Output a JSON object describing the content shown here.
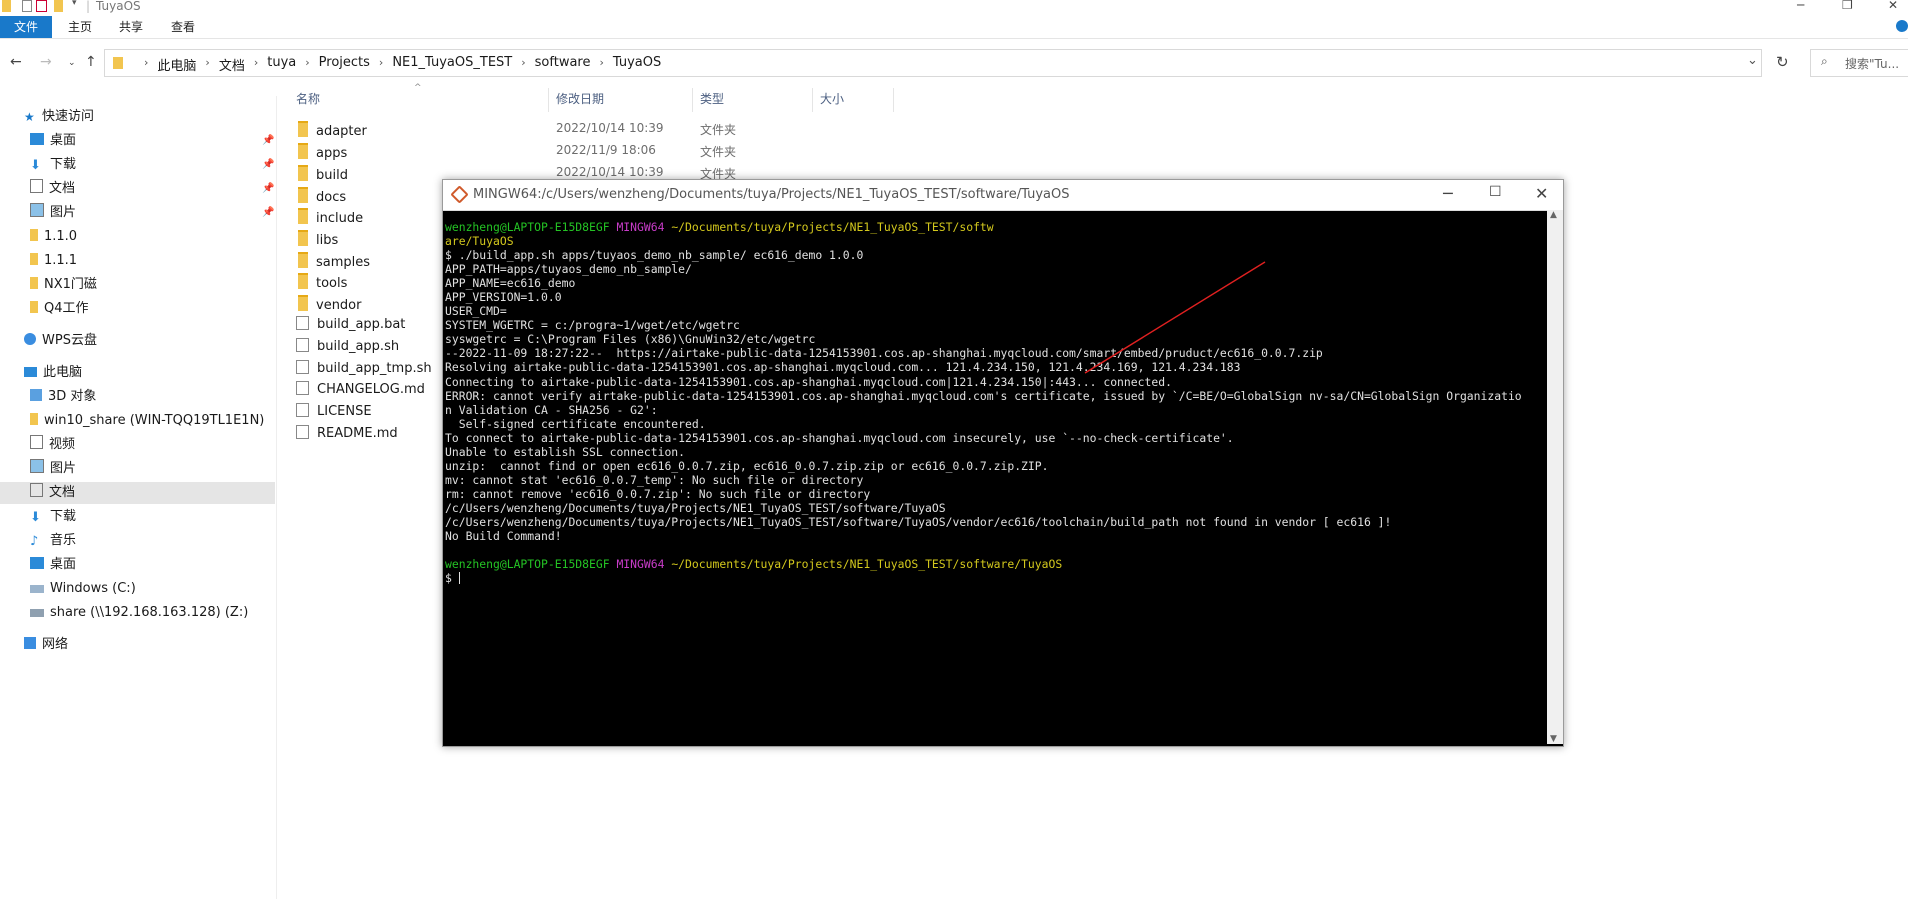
{
  "window": {
    "title": "TuyaOS"
  },
  "ribbon": {
    "tabs": [
      "文件",
      "主页",
      "共享",
      "查看"
    ]
  },
  "address": {
    "crumbs": [
      "此电脑",
      "文档",
      "tuya",
      "Projects",
      "NE1_TuyaOS_TEST",
      "software",
      "TuyaOS"
    ],
    "search_placeholder": "搜索\"Tu..."
  },
  "sidebar": {
    "quick_access": "快速访问",
    "quick_items": [
      "桌面",
      "下载",
      "文档",
      "图片",
      "1.1.0",
      "1.1.1",
      "NX1门磁",
      "Q4工作"
    ],
    "wps": "WPS云盘",
    "this_pc": "此电脑",
    "pc_items": [
      "3D 对象",
      "win10_share (WIN-TQQ19TL1E1N)",
      "视频",
      "图片",
      "文档",
      "下载",
      "音乐",
      "桌面",
      "Windows (C:)",
      "share (\\\\192.168.163.128) (Z:)"
    ],
    "network": "网络"
  },
  "columns": {
    "name": "名称",
    "date": "修改日期",
    "type": "类型",
    "size": "大小"
  },
  "files": [
    {
      "name": "adapter",
      "date": "2022/10/14 10:39",
      "type": "文件夹"
    },
    {
      "name": "apps",
      "date": "2022/11/9 18:06",
      "type": "文件夹"
    },
    {
      "name": "build",
      "date": "2022/10/14 10:39",
      "type": "文件夹"
    },
    {
      "name": "docs",
      "date": "",
      "type": ""
    },
    {
      "name": "include",
      "date": "",
      "type": ""
    },
    {
      "name": "libs",
      "date": "",
      "type": ""
    },
    {
      "name": "samples",
      "date": "",
      "type": ""
    },
    {
      "name": "tools",
      "date": "",
      "type": ""
    },
    {
      "name": "vendor",
      "date": "",
      "type": ""
    },
    {
      "name": "build_app.bat",
      "date": "",
      "type": ""
    },
    {
      "name": "build_app.sh",
      "date": "",
      "type": ""
    },
    {
      "name": "build_app_tmp.sh",
      "date": "",
      "type": ""
    },
    {
      "name": "CHANGELOG.md",
      "date": "",
      "type": ""
    },
    {
      "name": "LICENSE",
      "date": "",
      "type": ""
    },
    {
      "name": "README.md",
      "date": "",
      "type": ""
    }
  ],
  "terminal": {
    "title": "MINGW64:/c/Users/wenzheng/Documents/tuya/Projects/NE1_TuyaOS_TEST/software/TuyaOS",
    "prompt_user": "wenzheng@LAPTOP-E15D8EGF",
    "prompt_env": "MINGW64",
    "prompt_path_1a": "~/Documents/tuya/Projects/NE1_TuyaOS_TEST/softw",
    "prompt_path_1b": "are/TuyaOS",
    "output": [
      "$ ./build_app.sh apps/tuyaos_demo_nb_sample/ ec616_demo 1.0.0",
      "APP_PATH=apps/tuyaos_demo_nb_sample/",
      "APP_NAME=ec616_demo",
      "APP_VERSION=1.0.0",
      "USER_CMD=",
      "SYSTEM_WGETRC = c:/progra~1/wget/etc/wgetrc",
      "syswgetrc = C:\\Program Files (x86)\\GnuWin32/etc/wgetrc",
      "--2022-11-09 18:27:22--  https://airtake-public-data-1254153901.cos.ap-shanghai.myqcloud.com/smart/embed/pruduct/ec616_0.0.7.zip",
      "Resolving airtake-public-data-1254153901.cos.ap-shanghai.myqcloud.com... 121.4.234.150, 121.4.234.169, 121.4.234.183",
      "Connecting to airtake-public-data-1254153901.cos.ap-shanghai.myqcloud.com|121.4.234.150|:443... connected.",
      "ERROR: cannot verify airtake-public-data-1254153901.cos.ap-shanghai.myqcloud.com's certificate, issued by `/C=BE/O=GlobalSign nv-sa/CN=GlobalSign Organizatio",
      "n Validation CA - SHA256 - G2':",
      "  Self-signed certificate encountered.",
      "To connect to airtake-public-data-1254153901.cos.ap-shanghai.myqcloud.com insecurely, use `--no-check-certificate'.",
      "Unable to establish SSL connection.",
      "unzip:  cannot find or open ec616_0.0.7.zip, ec616_0.0.7.zip.zip or ec616_0.0.7.zip.ZIP.",
      "mv: cannot stat 'ec616_0.0.7_temp': No such file or directory",
      "rm: cannot remove 'ec616_0.0.7.zip': No such file or directory",
      "/c/Users/wenzheng/Documents/tuya/Projects/NE1_TuyaOS_TEST/software/TuyaOS",
      "/c/Users/wenzheng/Documents/tuya/Projects/NE1_TuyaOS_TEST/software/TuyaOS/vendor/ec616/toolchain/build_path not found in vendor [ ec616 ]!",
      "No Build Command!",
      ""
    ],
    "prompt_path_2": "~/Documents/tuya/Projects/NE1_TuyaOS_TEST/software/TuyaOS",
    "cursor_line": "$ "
  },
  "colors": {
    "accent": "#1979ca",
    "folder": "#f2c54f",
    "term_green": "#24c324",
    "term_magenta": "#c83cc8",
    "term_yellow": "#d3c81d",
    "annotation": "#e02020"
  }
}
